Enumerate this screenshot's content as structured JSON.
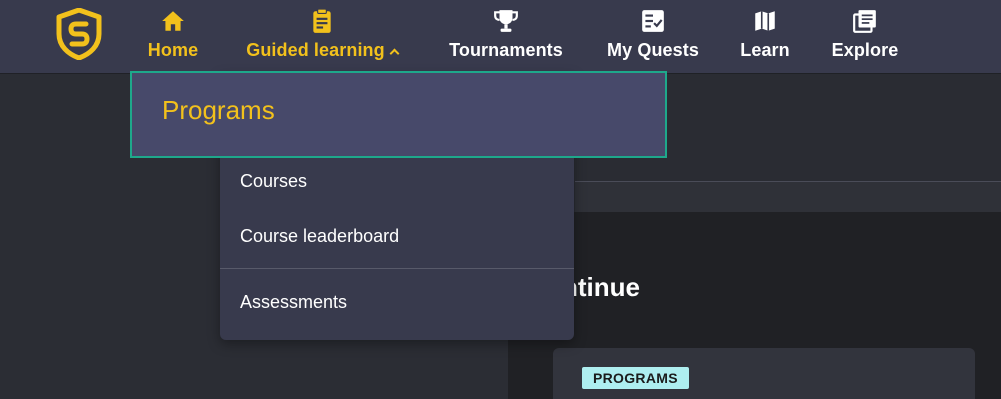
{
  "colors": {
    "accent": "#f2c11c",
    "topbar": "#383a4d",
    "focus_border": "#1ea88b",
    "badge_bg": "#aeeef0"
  },
  "nav": {
    "home": {
      "label": "Home",
      "icon": "home-icon"
    },
    "guided": {
      "label": "Guided learning",
      "icon": "clipboard-icon"
    },
    "tournaments": {
      "label": "Tournaments",
      "icon": "trophy-icon"
    },
    "quests": {
      "label": "My Quests",
      "icon": "checklist-icon"
    },
    "learn": {
      "label": "Learn",
      "icon": "map-icon"
    },
    "explore": {
      "label": "Explore",
      "icon": "library-icon"
    }
  },
  "dropdown": {
    "programs": "Programs",
    "courses": "Courses",
    "course_leaderboard": "Course leaderboard",
    "assessments": "Assessments"
  },
  "main": {
    "heading_fragment": "ntinue",
    "card_badge": "PROGRAMS"
  }
}
